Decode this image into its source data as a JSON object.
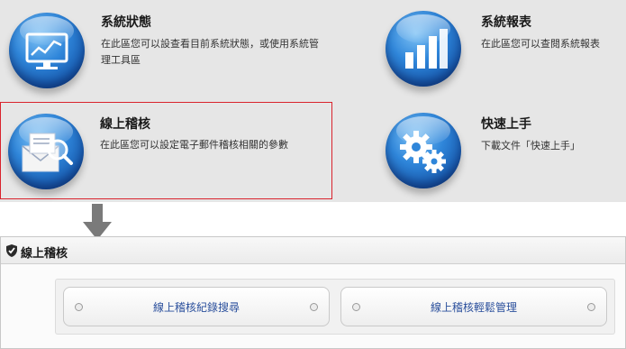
{
  "tiles": {
    "status": {
      "title": "系統狀態",
      "desc": "在此區您可以設查看目前系統狀態，或使用系統管理工具區",
      "icon": "monitor-chart-icon"
    },
    "report": {
      "title": "系統報表",
      "desc": "在此區您可以查閱系統報表",
      "icon": "bar-chart-icon"
    },
    "audit": {
      "title": "線上稽核",
      "desc": "在此區您可以設定電子郵件稽核相關的參數",
      "icon": "mail-magnifier-icon",
      "highlight_color": "#d9232d"
    },
    "quick": {
      "title": "快速上手",
      "desc": "下載文件「快速上手」",
      "icon": "gears-icon"
    }
  },
  "lower": {
    "title": "線上稽核",
    "buttons": {
      "search": "線上稽核紀錄搜尋",
      "manage": "線上稽核輕鬆管理"
    }
  },
  "colors": {
    "orb_blue": "#1a5fb4",
    "highlight": "#d9232d",
    "link_text": "#2a4f9c"
  }
}
